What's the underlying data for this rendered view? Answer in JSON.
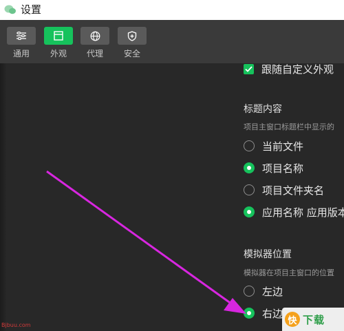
{
  "window": {
    "title": "设置"
  },
  "toolbar": {
    "items": [
      {
        "label": "通用",
        "icon": "sliders-icon",
        "active": false
      },
      {
        "label": "外观",
        "icon": "layout-icon",
        "active": true
      },
      {
        "label": "代理",
        "icon": "globe-icon",
        "active": false
      },
      {
        "label": "安全",
        "icon": "shield-icon",
        "active": false
      }
    ]
  },
  "appearance": {
    "follow_custom": {
      "label": "跟随自定义外观",
      "checked": true
    }
  },
  "title_content": {
    "heading": "标题内容",
    "description": "项目主窗口标题栏中显示的",
    "options": [
      {
        "label": "当前文件",
        "selected": false
      },
      {
        "label": "项目名称",
        "selected": true
      },
      {
        "label": "项目文件夹名",
        "selected": false
      },
      {
        "label": "应用名称 应用版本",
        "selected": true
      }
    ]
  },
  "simulator_position": {
    "heading": "模拟器位置",
    "description": "模拟器在项目主窗口的位置",
    "options": [
      {
        "label": "左边",
        "selected": false
      },
      {
        "label": "右边",
        "selected": true
      }
    ]
  },
  "watermark": {
    "site": "Bjbuu.com",
    "brand": "下载",
    "logo_char": "快"
  },
  "colors": {
    "accent": "#16c25c",
    "arrow": "#d826e0",
    "background": "#282828",
    "toolbar": "#3a3a3a"
  }
}
